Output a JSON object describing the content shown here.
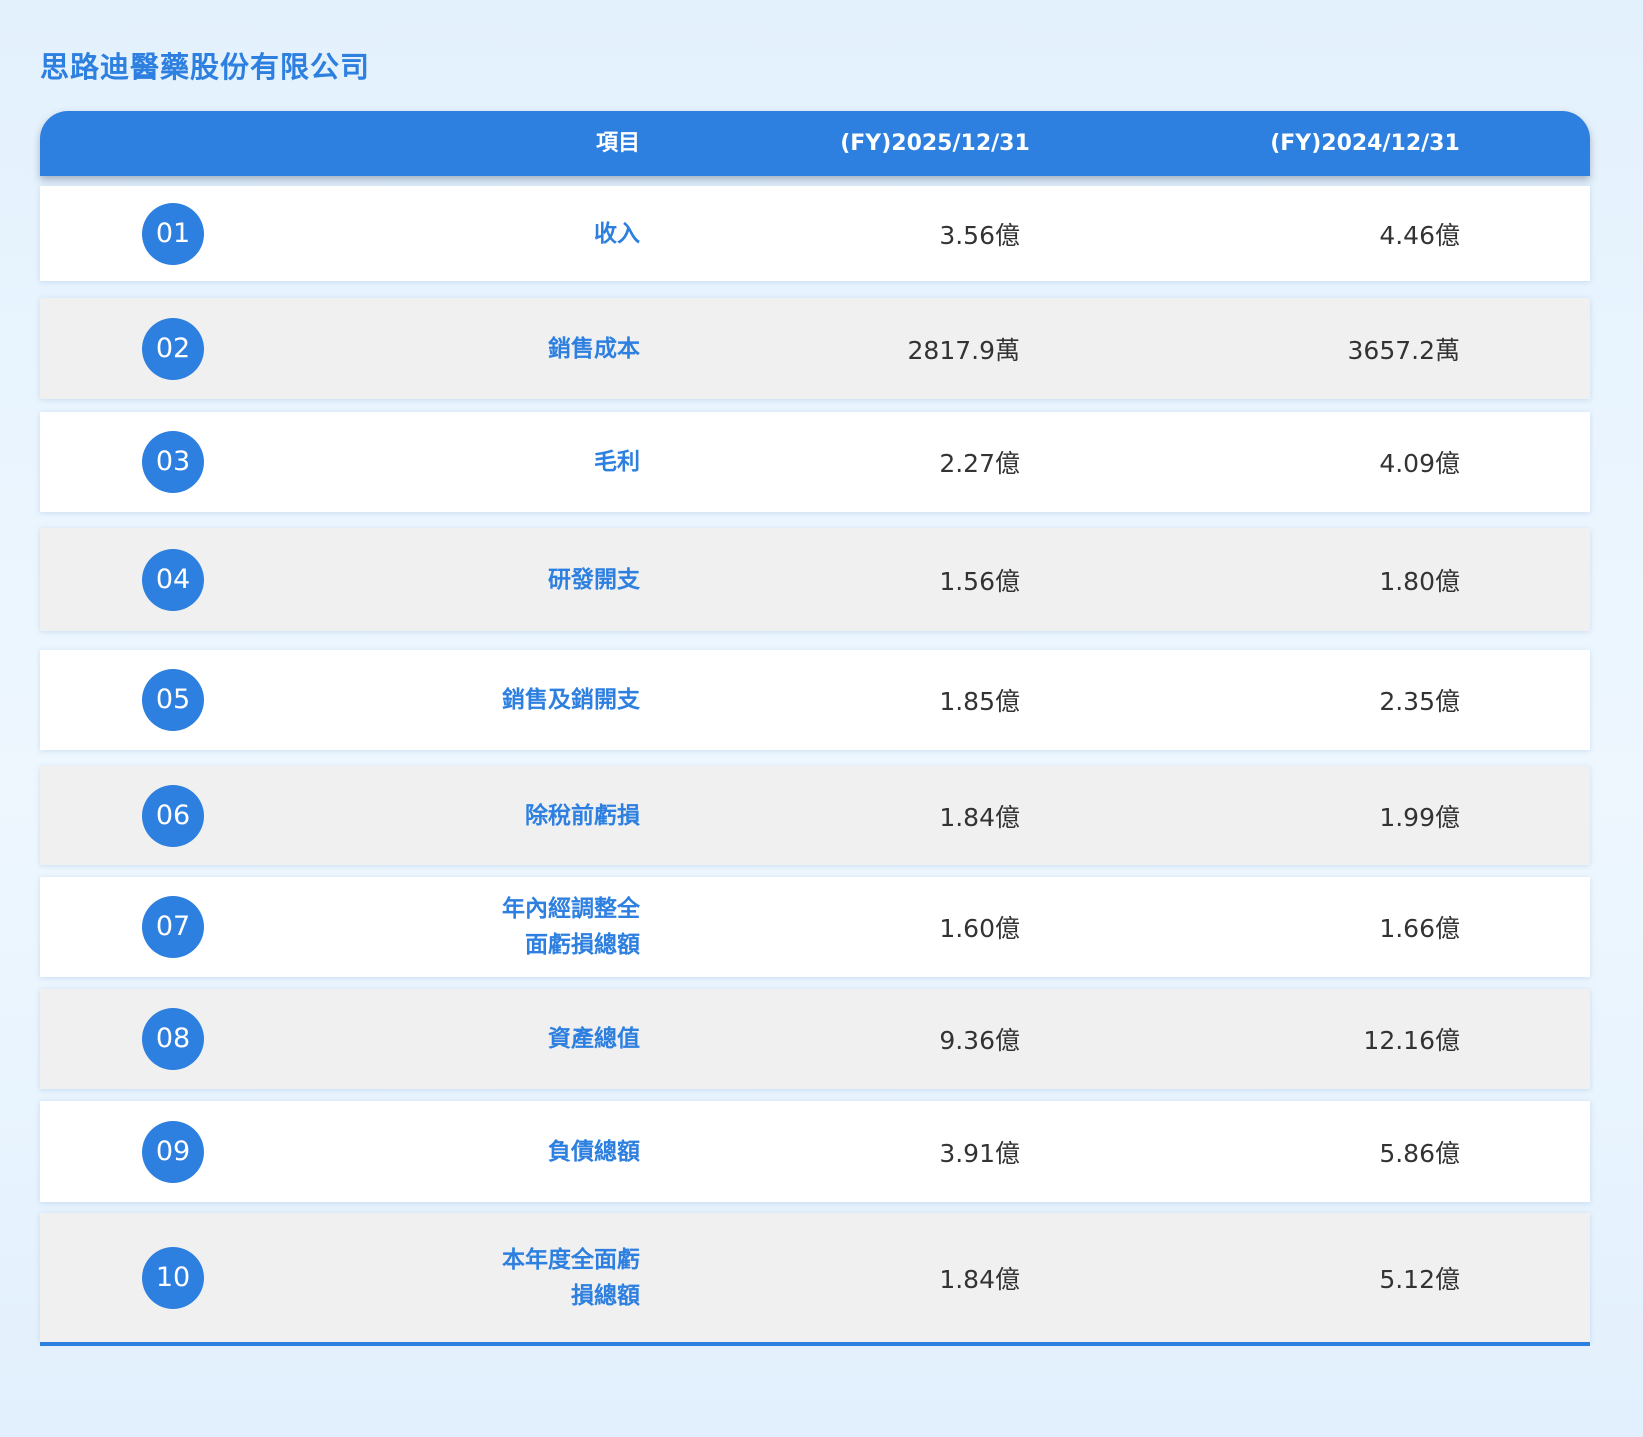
{
  "company": "思路迪醫藥股份有限公司",
  "header": {
    "item": "項目",
    "year1": "(FY)2025/12/31",
    "year2": "(FY)2024/12/31"
  },
  "rows": [
    {
      "no": "01",
      "item": "收入",
      "y1": "3.56億",
      "y2": "4.46億"
    },
    {
      "no": "02",
      "item": "銷售成本",
      "y1": "2817.9萬",
      "y2": "3657.2萬"
    },
    {
      "no": "03",
      "item": "毛利",
      "y1": "2.27億",
      "y2": "4.09億"
    },
    {
      "no": "04",
      "item": "研發開支",
      "y1": "1.56億",
      "y2": "1.80億"
    },
    {
      "no": "05",
      "item": "銷售及銷開支",
      "y1": "1.85億",
      "y2": "2.35億"
    },
    {
      "no": "06",
      "item": "除稅前虧損",
      "y1": "1.84億",
      "y2": "1.99億"
    },
    {
      "no": "07",
      "item": "年內經調整全面虧損總額",
      "y1": "1.60億",
      "y2": "1.66億"
    },
    {
      "no": "08",
      "item": "資產總值",
      "y1": "9.36億",
      "y2": "12.16億"
    },
    {
      "no": "09",
      "item": "負債總額",
      "y1": "3.91億",
      "y2": "5.86億"
    },
    {
      "no": "10",
      "item": "本年度全面虧損總額",
      "y1": "1.84億",
      "y2": "5.12億"
    }
  ]
}
